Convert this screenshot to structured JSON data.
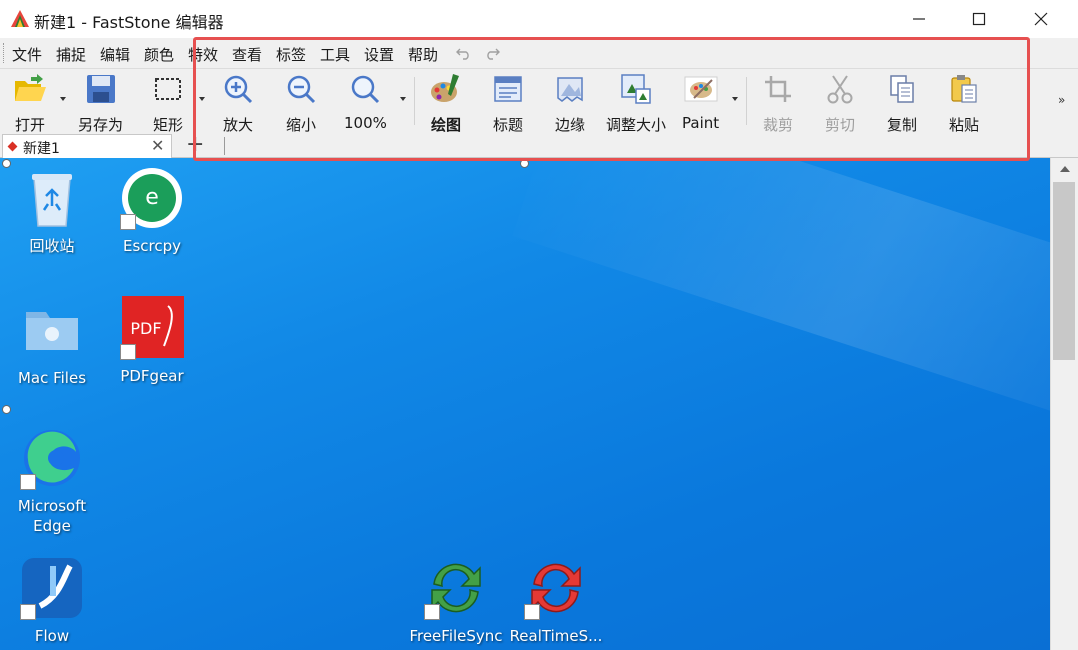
{
  "window": {
    "title": "新建1 - FastStone 编辑器",
    "controls": {
      "minimize": "minimize",
      "maximize": "maximize",
      "close": "close"
    }
  },
  "menu": [
    "文件",
    "捕捉",
    "编辑",
    "颜色",
    "特效",
    "查看",
    "标签",
    "工具",
    "设置",
    "帮助"
  ],
  "toolbar": {
    "open": "打开",
    "save_as": "另存为",
    "rectangle": "矩形",
    "zoom_in": "放大",
    "zoom_out": "缩小",
    "zoom_100": "100%",
    "draw": "绘图",
    "caption": "标题",
    "edge": "边缘",
    "resize": "调整大小",
    "paint": "Paint",
    "crop": "裁剪",
    "cut": "剪切",
    "copy": "复制",
    "paste": "粘贴"
  },
  "tabs": {
    "active": "新建1",
    "new_tab": "+"
  },
  "desktop": {
    "icons": [
      "回收站",
      "Escrcpy",
      "Mac Files",
      "PDFgear",
      "Microsoft Edge",
      "Flow",
      "FreeFileSync",
      "RealTimeS..."
    ]
  },
  "colors": {
    "highlight": "#e65050",
    "desktop": "#1188e6",
    "chrome": "#f0f0f0"
  }
}
